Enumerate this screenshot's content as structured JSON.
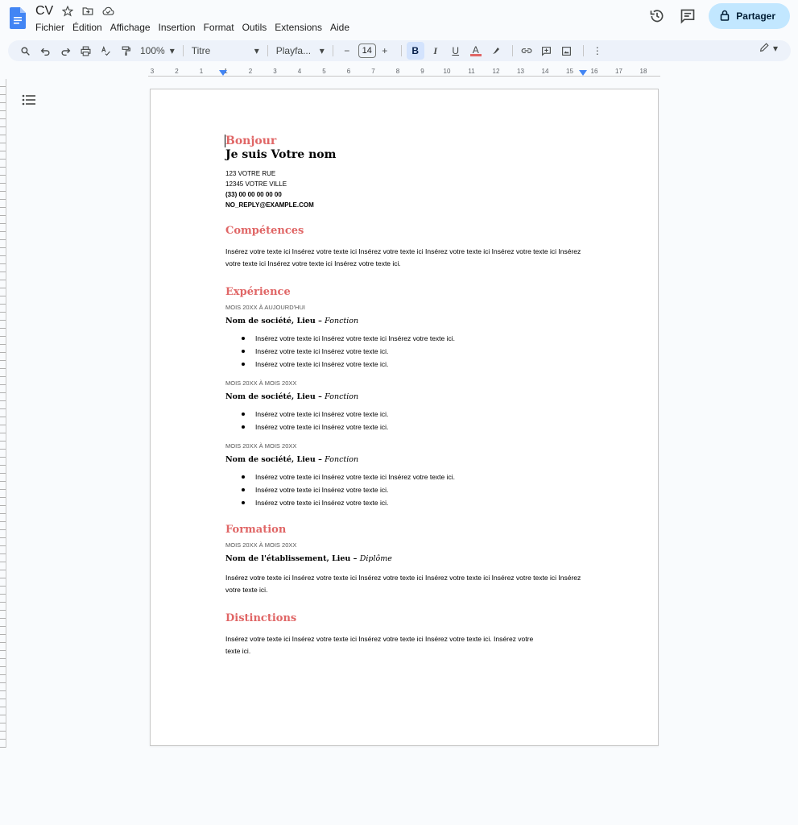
{
  "app": {
    "doc_title": "CV",
    "menu": [
      "Fichier",
      "Édition",
      "Affichage",
      "Insertion",
      "Format",
      "Outils",
      "Extensions",
      "Aide"
    ],
    "share_label": "Partager",
    "brand_color": "#1a73e8",
    "accent_color": "#e06666"
  },
  "toolbar": {
    "zoom": "100%",
    "style": "Titre",
    "font": "Playfa...",
    "font_size": "14",
    "minus": "−",
    "plus": "+",
    "bold": "B",
    "italic": "I",
    "underline": "U",
    "text_color": "A",
    "more": "⋮"
  },
  "ruler": {
    "numbers": [
      "3",
      "2",
      "1",
      "1",
      "2",
      "3",
      "4",
      "5",
      "6",
      "7",
      "8",
      "9",
      "10",
      "11",
      "12",
      "13",
      "14",
      "15",
      "16",
      "17",
      "18"
    ]
  },
  "doc": {
    "hello": "Bonjour",
    "name": "Je suis Votre nom",
    "address": [
      "123 VOTRE RUE",
      "12345 VOTRE VILLE"
    ],
    "phone": "(33) 00 00 00 00 00",
    "email": "NO_REPLY@EXAMPLE.COM",
    "skills_title": "Compétences",
    "skills_text": "Insérez votre texte ici Insérez votre texte ici Insérez votre texte ici Insérez votre texte ici Insérez votre texte ici Insérez votre texte ici Insérez votre texte ici Insérez votre texte ici.",
    "experience_title": "Expérience",
    "jobs": [
      {
        "dates": "MOIS 20XX À AUJOURD'HUI",
        "company": "Nom de société, Lieu – ",
        "role": "Fonction",
        "bullets": [
          "Insérez votre texte ici Insérez votre texte ici Insérez votre texte ici.",
          "Insérez votre texte ici Insérez votre texte ici.",
          "Insérez votre texte ici Insérez votre texte ici."
        ]
      },
      {
        "dates": "MOIS 20XX À MOIS 20XX",
        "company": "Nom de société, Lieu – ",
        "role": "Fonction",
        "bullets": [
          "Insérez votre texte ici Insérez votre texte ici.",
          "Insérez votre texte ici Insérez votre texte ici."
        ]
      },
      {
        "dates": "MOIS 20XX À MOIS 20XX",
        "company": "Nom de société, Lieu – ",
        "role": "Fonction",
        "bullets": [
          "Insérez votre texte ici Insérez votre texte ici Insérez votre texte ici.",
          "Insérez votre texte ici Insérez votre texte ici.",
          "Insérez votre texte ici Insérez votre texte ici."
        ]
      }
    ],
    "education_title": "Formation",
    "education": {
      "dates": "MOIS 20XX À MOIS 20XX",
      "school": "Nom de l'établissement, Lieu – ",
      "degree": "Diplôme",
      "text": "Insérez votre texte ici Insérez votre texte ici Insérez votre texte ici Insérez votre texte ici Insérez votre texte ici Insérez votre texte ici."
    },
    "awards_title": "Distinctions",
    "awards_text": "Insérez votre texte ici Insérez votre texte ici Insérez votre texte ici Insérez votre texte ici. Insérez votre texte ici."
  }
}
